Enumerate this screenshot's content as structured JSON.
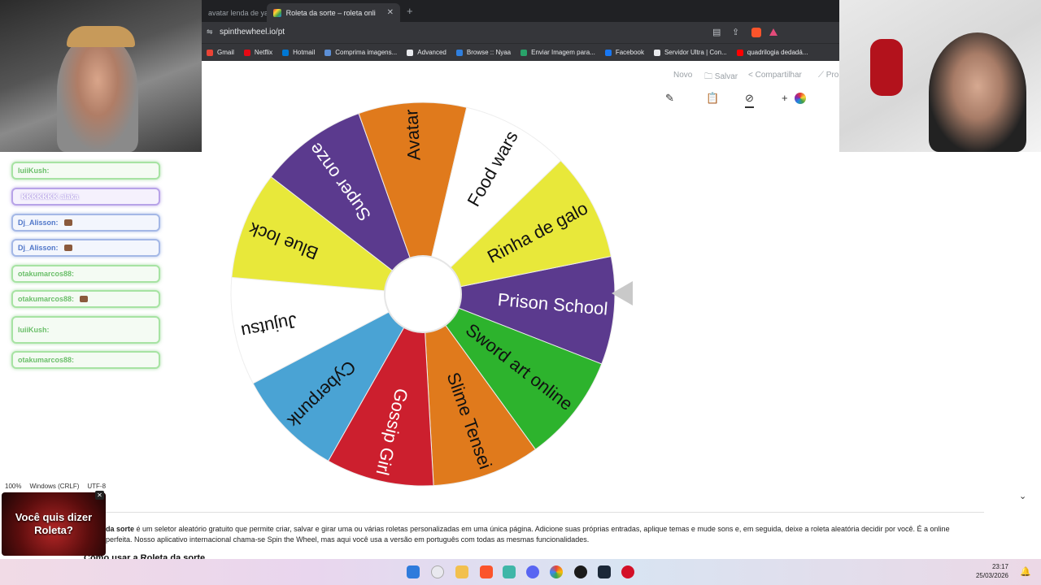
{
  "browser": {
    "tabs": [
      {
        "title": "avatar lenda de yang"
      },
      {
        "title": "Roleta da sorte – roleta online g",
        "close": "✕"
      }
    ],
    "new_tab": "+",
    "url": "spinthewheel.io/pt",
    "bookmarks": [
      {
        "label": "Gmail",
        "color": "#ea4335"
      },
      {
        "label": "Netflix",
        "color": "#e50914"
      },
      {
        "label": "Hotmail",
        "color": "#0078d4"
      },
      {
        "label": "Comprima imagens...",
        "color": "#5c8fd6"
      },
      {
        "label": "Advanced",
        "color": "#e8eaed"
      },
      {
        "label": "Browse :: Nyaa",
        "color": "#2f7fde"
      },
      {
        "label": "Enviar Imagem para...",
        "color": "#29a36a"
      },
      {
        "label": "Facebook",
        "color": "#1877f2"
      },
      {
        "label": "Servidor Ultra | Con...",
        "color": "#e8eaed"
      },
      {
        "label": "quadrilogia dedadá...",
        "color": "#ff0000"
      }
    ]
  },
  "toolbar": {
    "novo": "Novo",
    "salvar": "Salvar",
    "compartilhar": "Compartilhar",
    "pro": "Pro"
  },
  "chat": {
    "messages": [
      {
        "user": "luiiKush:",
        "text": "",
        "style": "green"
      },
      {
        "user": "",
        "text": "KKKKKKK alaka",
        "style": "purple"
      },
      {
        "user": "Dj_Alisson:",
        "text": "",
        "style": "blue",
        "emote": true
      },
      {
        "user": "Dj_Alisson:",
        "text": "",
        "style": "blue",
        "emote": true
      },
      {
        "user": "otakumarcos88:",
        "text": "",
        "style": "green"
      },
      {
        "user": "otakumarcos88:",
        "text": "",
        "style": "green",
        "emote": true
      },
      {
        "user": "luiiKush:",
        "text": "",
        "style": "green"
      },
      {
        "user": "otakumarcos88:",
        "text": "",
        "style": "green"
      }
    ]
  },
  "editor_status": {
    "zoom": "100%",
    "line_ending": "Windows (CRLF)",
    "encoding": "UTF-8"
  },
  "wheel": {
    "segments": [
      {
        "label": "Prison School",
        "color": "#5b3a8e",
        "text_color": "#ffffff"
      },
      {
        "label": "Sword art online",
        "color": "#2db32d",
        "text_color": "#111111"
      },
      {
        "label": "Slime Tensei",
        "color": "#e07a1c",
        "text_color": "#111111"
      },
      {
        "label": "Gossip Girl",
        "color": "#cc1f2e",
        "text_color": "#ffffff"
      },
      {
        "label": "Cyberpunk",
        "color": "#4aa3d4",
        "text_color": "#111111"
      },
      {
        "label": "Jujutsu",
        "color": "#ffffff",
        "text_color": "#111111"
      },
      {
        "label": "Blue lock",
        "color": "#e8e83a",
        "text_color": "#111111"
      },
      {
        "label": "Super onze",
        "color": "#5b3a8e",
        "text_color": "#ffffff"
      },
      {
        "label": "Avatar",
        "color": "#e07a1c",
        "text_color": "#111111"
      },
      {
        "label": "Food wars",
        "color": "#ffffff",
        "text_color": "#111111"
      },
      {
        "label": "Rinha de galo",
        "color": "#e8e83a",
        "text_color": "#111111"
      }
    ]
  },
  "description": {
    "highlight": "da sorte",
    "text": " é um seletor aleatório gratuito que permite criar, salvar e girar uma ou várias roletas personalizadas em uma única página. Adicione suas próprias entradas, aplique temas e mude sons e, em seguida, deixe a roleta aleatória decidir por você. É a online perfeita. Nosso aplicativo internacional chama-se Spin the Wheel, mas aqui você usa a versão em português com todas as mesmas funcionalidades.",
    "howto": "Como usar a Roleta da sorte"
  },
  "promo": {
    "text": "Você quis dizer Roleta?",
    "close": "✕"
  },
  "taskbar": {
    "time": "23:17",
    "date": "25/03/2026"
  }
}
